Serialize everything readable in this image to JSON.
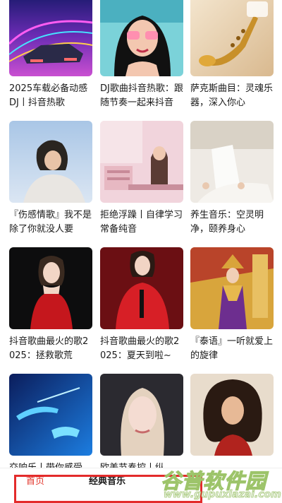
{
  "playlists": [
    {
      "title": "2025车载必备动感DJ丨抖音热歌",
      "cover": "neon-car"
    },
    {
      "title": "DJ歌曲抖音热歌：跟随节奏一起来抖音",
      "cover": "anime-girl"
    },
    {
      "title": "萨克斯曲目：灵魂乐器，深入你心",
      "cover": "saxophone"
    },
    {
      "title": "『伤感情歌』我不是除了你就没人要",
      "cover": "girl-sweater"
    },
    {
      "title": "拒绝浮躁丨自律学习常备纯音",
      "cover": "study-room"
    },
    {
      "title": "养生音乐：空灵明净，颐养身心",
      "cover": "meditation"
    },
    {
      "title": "抖音歌曲最火的歌2025：拯救歌荒",
      "cover": "woman-red-dress"
    },
    {
      "title": "抖音歌曲最火的歌2025：夏天到啦~",
      "cover": "woman-red-suit"
    },
    {
      "title": "『泰语』一听就爱上的旋律",
      "cover": "thai-dancer"
    },
    {
      "title": "交响乐丨带你感受",
      "cover": "conductor-hands"
    },
    {
      "title": "欧美节奏控丨纵",
      "cover": "blonde-woman"
    },
    {
      "title": "",
      "cover": "curly-hair-woman"
    }
  ],
  "tabbar": {
    "home_label": "首页",
    "classic_label": "经典音乐"
  },
  "watermark": {
    "name": "谷普软件园",
    "url": "www.gupuxlazai.com"
  },
  "colors": {
    "active_tab": "#e2342a",
    "highlight": "#e32b2b"
  }
}
